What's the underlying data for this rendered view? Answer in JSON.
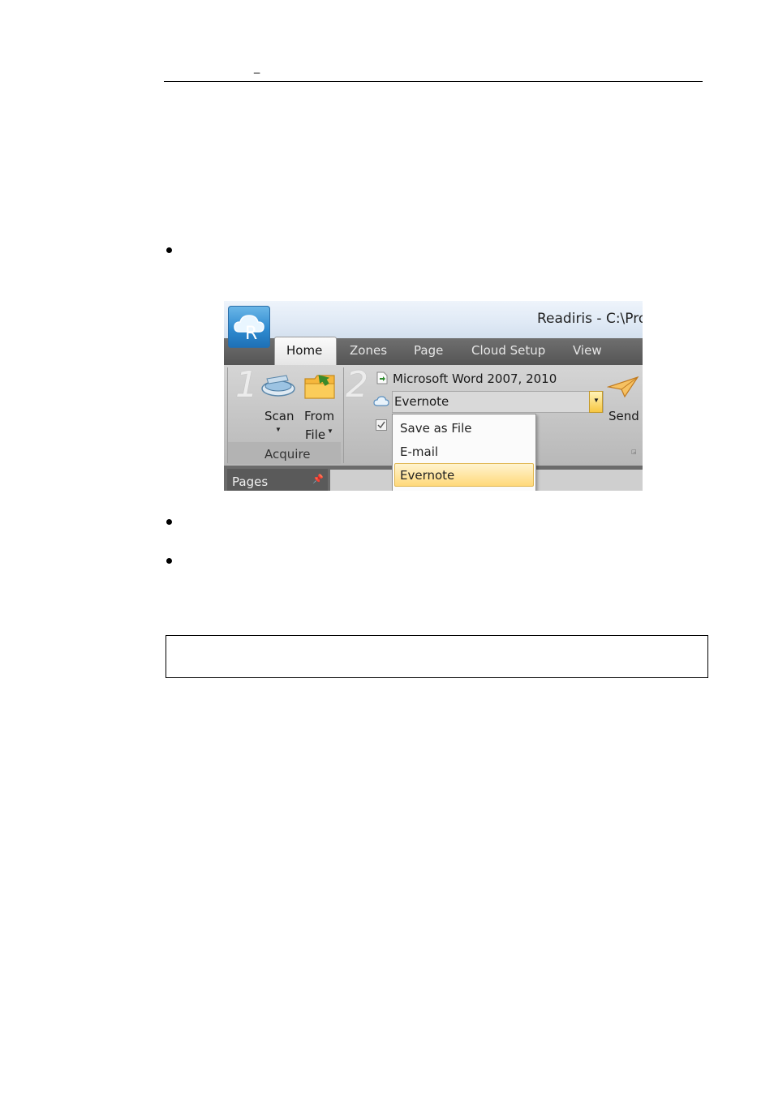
{
  "page": {
    "header_mark": "_"
  },
  "screenshot": {
    "app_title": "Readiris - C:\\Pro",
    "app_logo_letter": "R",
    "tabs": [
      {
        "label": "Home",
        "active": true
      },
      {
        "label": "Zones",
        "active": false
      },
      {
        "label": "Page",
        "active": false
      },
      {
        "label": "Cloud Setup",
        "active": false
      },
      {
        "label": "View",
        "active": false
      }
    ],
    "acquire_group": {
      "step_number": "1",
      "scan_label": "Scan",
      "from_label": "From",
      "file_label": "File",
      "group_label": "Acquire"
    },
    "send_group": {
      "step_number": "2",
      "format_label": "Microsoft Word 2007, 2010",
      "destination_value": "Evernote",
      "send_label": "Send",
      "checkbox_checked": true
    },
    "destination_dropdown": {
      "options": [
        "Save as File",
        "E-mail",
        "Evernote"
      ],
      "highlighted": "Evernote"
    },
    "pages_pane": {
      "label": "Pages",
      "pin_icon": "pin-icon"
    },
    "colors": {
      "highlight": "#ffd97a",
      "accent_blue": "#2f8bd0"
    }
  }
}
